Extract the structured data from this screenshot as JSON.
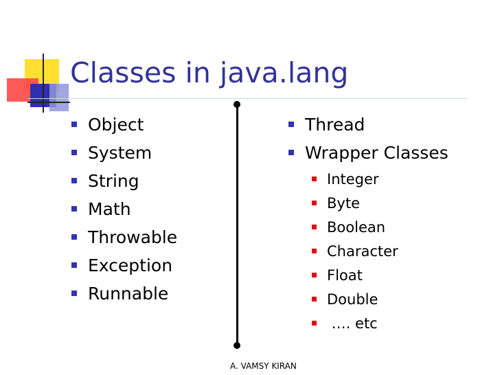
{
  "slide": {
    "title": "Classes in java.lang",
    "left_items": [
      "Object",
      "System",
      "String",
      "Math",
      "Throwable",
      "Exception",
      "Runnable"
    ],
    "right_items": [
      "Thread",
      "Wrapper Classes"
    ],
    "wrapper_subitems": [
      "Integer",
      "Byte",
      "Boolean",
      "Character",
      "Float",
      "Double",
      " …. etc"
    ],
    "footer": "A. VAMSY KIRAN"
  },
  "colors": {
    "title": "#333399",
    "bullet_primary": "#3333b3",
    "bullet_secondary": "#e01010",
    "accent_yellow": "#ffe030",
    "accent_red": "#ff4a4a",
    "accent_blue": "#2f2fb0"
  }
}
